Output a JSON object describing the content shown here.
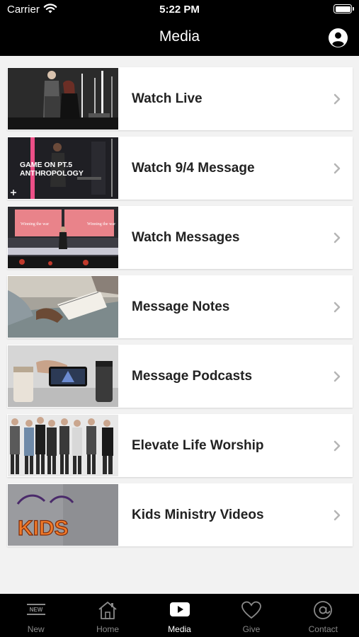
{
  "status_bar": {
    "carrier": "Carrier",
    "time": "5:22 PM"
  },
  "nav": {
    "title": "Media"
  },
  "items": [
    {
      "label": "Watch Live"
    },
    {
      "label": "Watch 9/4 Message",
      "thumb_text_line1": "GAME ON PT.5",
      "thumb_text_line2": "ANTHROPOLOGY"
    },
    {
      "label": "Watch Messages",
      "thumb_screen_text": "Winning the war"
    },
    {
      "label": "Message Notes"
    },
    {
      "label": "Message Podcasts"
    },
    {
      "label": "Elevate Life Worship"
    },
    {
      "label": "Kids Ministry Videos",
      "thumb_text": "KIDS"
    }
  ],
  "tabs": [
    {
      "label": "New",
      "icon": "new-icon"
    },
    {
      "label": "Home",
      "icon": "home-icon"
    },
    {
      "label": "Media",
      "icon": "play-icon",
      "active": true
    },
    {
      "label": "Give",
      "icon": "heart-icon"
    },
    {
      "label": "Contact",
      "icon": "at-icon"
    }
  ],
  "colors": {
    "bars": "#000000",
    "background": "#f2f2f2",
    "active_tab": "#ffffff",
    "inactive_tab": "#8a8a8a"
  }
}
